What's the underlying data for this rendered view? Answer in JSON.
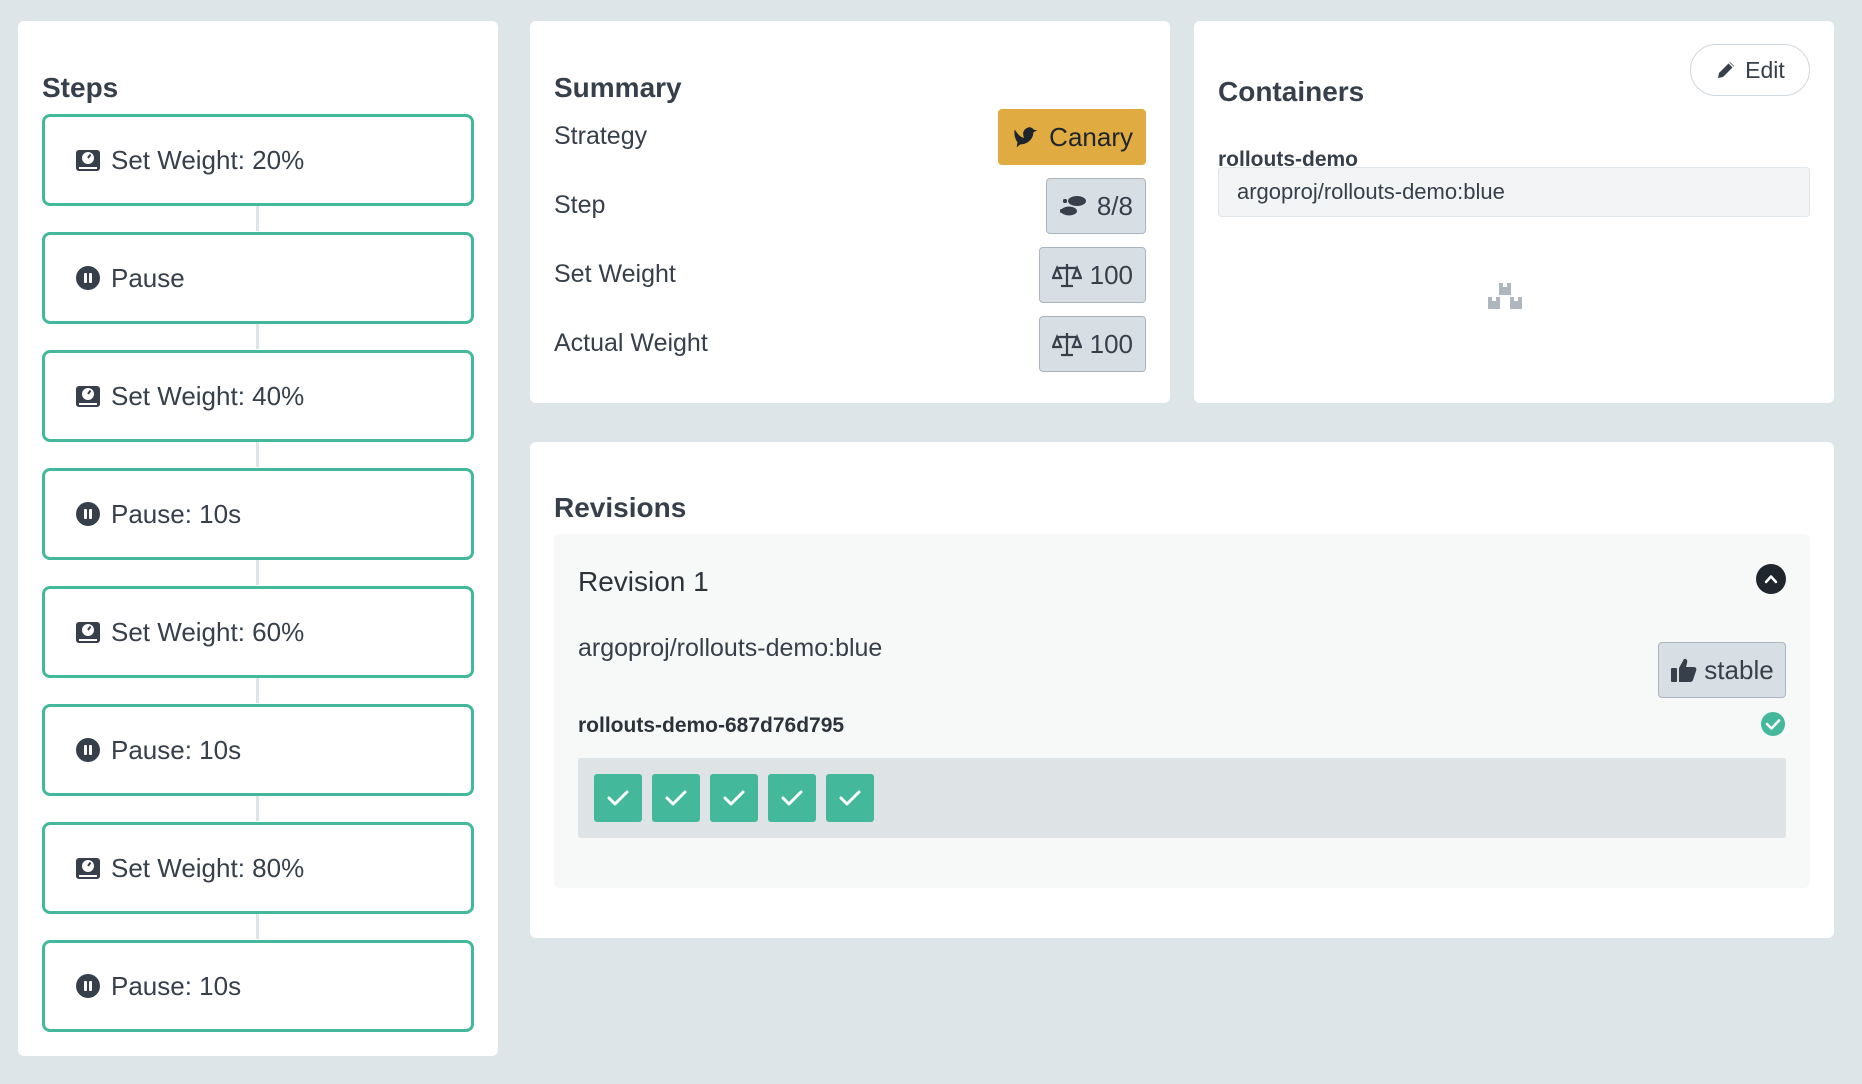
{
  "steps": {
    "title": "Steps",
    "items": [
      {
        "label": "Set Weight: 20%",
        "icon": "weight-scale-icon"
      },
      {
        "label": "Pause",
        "icon": "pause-circle-icon"
      },
      {
        "label": "Set Weight: 40%",
        "icon": "weight-scale-icon"
      },
      {
        "label": "Pause: 10s",
        "icon": "pause-circle-icon"
      },
      {
        "label": "Set Weight: 60%",
        "icon": "weight-scale-icon"
      },
      {
        "label": "Pause: 10s",
        "icon": "pause-circle-icon"
      },
      {
        "label": "Set Weight: 80%",
        "icon": "weight-scale-icon"
      },
      {
        "label": "Pause: 10s",
        "icon": "pause-circle-icon"
      }
    ]
  },
  "summary": {
    "title": "Summary",
    "strategy_label": "Strategy",
    "strategy_value": "Canary",
    "step_label": "Step",
    "step_value": "8/8",
    "set_weight_label": "Set Weight",
    "set_weight_value": "100",
    "actual_weight_label": "Actual Weight",
    "actual_weight_value": "100"
  },
  "containers": {
    "title": "Containers",
    "edit_label": "Edit",
    "name": "rollouts-demo",
    "image": "argoproj/rollouts-demo:blue"
  },
  "revisions": {
    "title": "Revisions",
    "items": [
      {
        "title": "Revision 1",
        "image": "argoproj/rollouts-demo:blue",
        "badge": "stable",
        "replicaset": "rollouts-demo-687d76d795",
        "pods": 5
      }
    ]
  },
  "colors": {
    "background": "#dee5e9",
    "step_border": "#44b89a",
    "canary": "#e0ac42",
    "pod_ok": "#44b89a"
  }
}
